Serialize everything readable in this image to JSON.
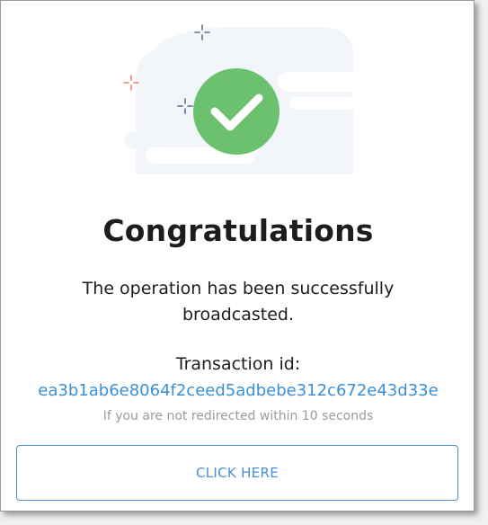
{
  "dialog": {
    "title": "Congratulations",
    "message": "The operation has been successfully broadcasted.",
    "transaction_label": "Transaction id:",
    "transaction_id": "ea3b1ab6e8064f2ceed5adbebe312c672e43d33e",
    "redirect_note": "If you are not redirected within 10 seconds",
    "button_label": "CLICK HERE"
  },
  "colors": {
    "success_green": "#6cc16e",
    "link_blue": "#3b8fd6",
    "button_border": "#4a90d9",
    "illustration_bg": "#f2f6fb"
  },
  "icons": {
    "success": "checkmark-circle-icon",
    "sparkles": [
      "sparkle-icon"
    ]
  }
}
